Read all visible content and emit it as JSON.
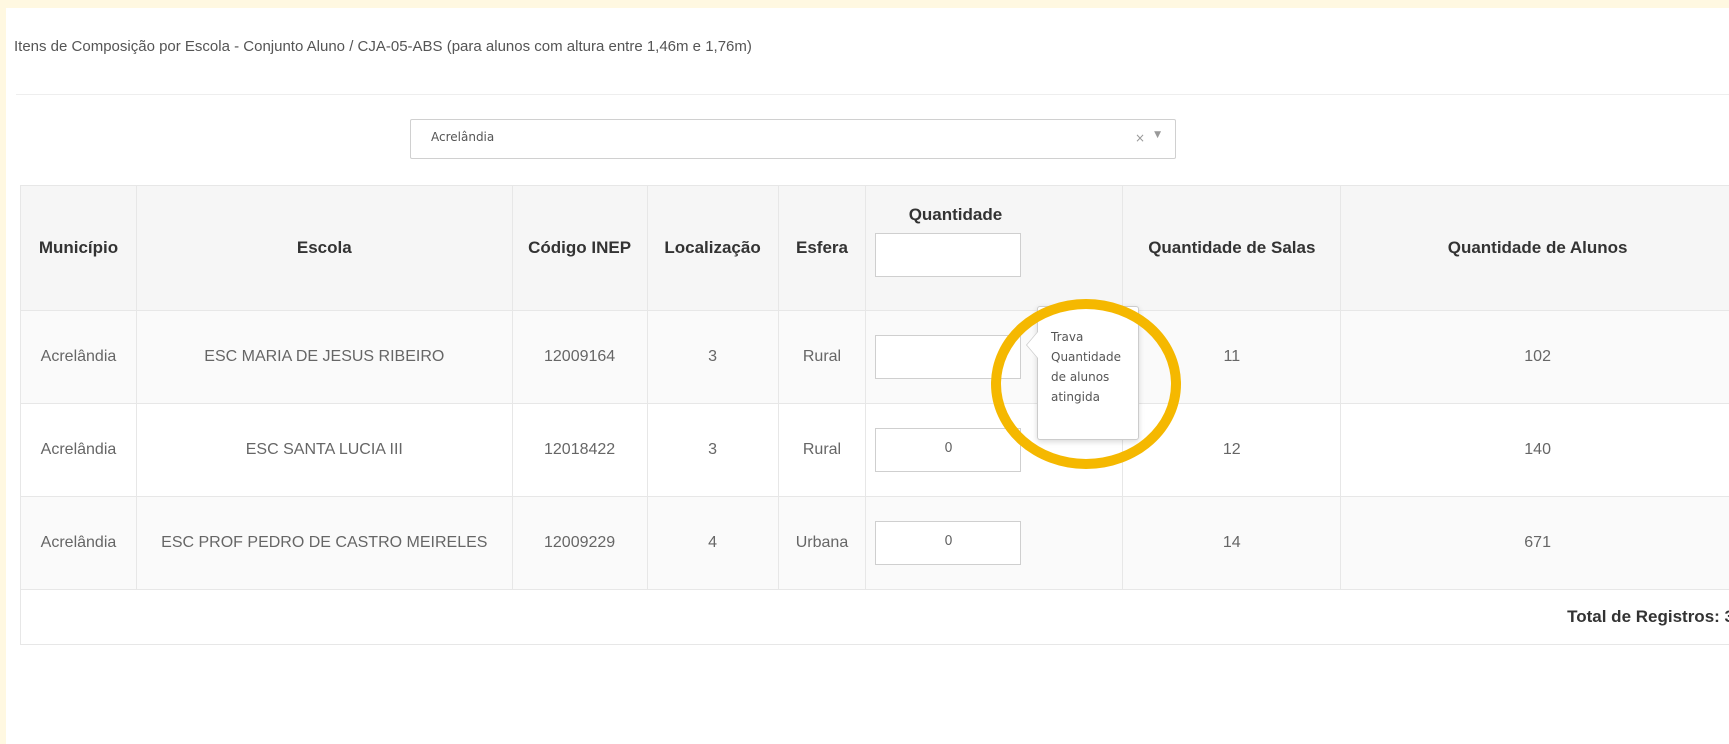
{
  "heading": "Itens de Composição por Escola - Conjunto Aluno / CJA-05-ABS (para alunos com altura entre 1,46m e 1,76m)",
  "municipio_select": {
    "value": "Acrelândia",
    "clear_glyph": "×",
    "arrow_glyph": "▼"
  },
  "table": {
    "headers": {
      "municipio": "Município",
      "escola": "Escola",
      "codigo_inep": "Código INEP",
      "localizacao": "Localização",
      "esfera": "Esfera",
      "quantidade": "Quantidade",
      "quantidade_salas": "Quantidade de Salas",
      "quantidade_alunos": "Quantidade de Alunos"
    },
    "header_quantidade_input": "",
    "rows": [
      {
        "municipio": "Acrelândia",
        "escola": "ESC MARIA DE JESUS RIBEIRO",
        "codigo_inep": "12009164",
        "localizacao": "3",
        "esfera": "Rural",
        "quantidade": "",
        "salas": "11",
        "alunos": "102"
      },
      {
        "municipio": "Acrelândia",
        "escola": "ESC SANTA LUCIA III",
        "codigo_inep": "12018422",
        "localizacao": "3",
        "esfera": "Rural",
        "quantidade": "0",
        "salas": "12",
        "alunos": "140"
      },
      {
        "municipio": "Acrelândia",
        "escola": "ESC PROF PEDRO DE CASTRO MEIRELES",
        "codigo_inep": "12009229",
        "localizacao": "4",
        "esfera": "Urbana",
        "quantidade": "0",
        "salas": "14",
        "alunos": "671"
      }
    ],
    "footer": "Total de Registros: 3"
  },
  "tooltip": {
    "lines": [
      "Trava",
      "Quantidade",
      "de alunos",
      "atingida"
    ]
  },
  "colors": {
    "highlight": "#f5b800",
    "page_border": "#fff8e1",
    "header_bg": "#f6f6f6"
  }
}
